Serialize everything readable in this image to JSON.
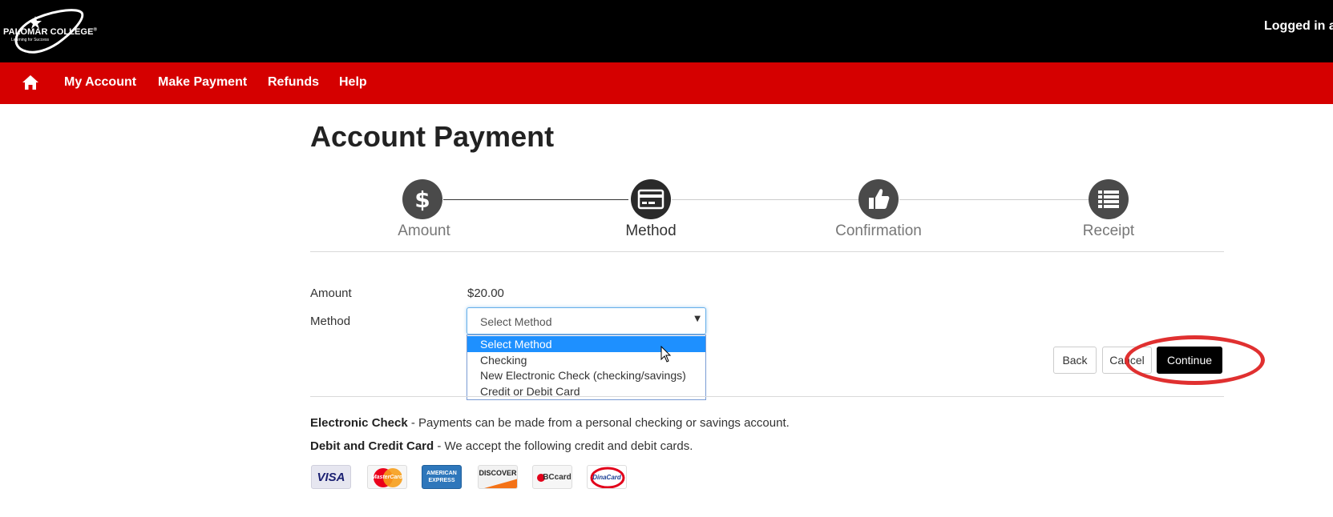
{
  "header": {
    "logo_name": "PALOMAR COLLEGE",
    "logo_mark": "®",
    "logo_tagline": "Learning for Success",
    "logged_in_text": "Logged in a"
  },
  "nav": {
    "home_icon": "home-icon",
    "items": [
      {
        "label": "My Account"
      },
      {
        "label": "Make Payment"
      },
      {
        "label": "Refunds"
      },
      {
        "label": "Help"
      }
    ]
  },
  "page": {
    "title": "Account Payment"
  },
  "steps": [
    {
      "label": "Amount",
      "icon": "dollar-icon",
      "active": false
    },
    {
      "label": "Method",
      "icon": "credit-card-icon",
      "active": true
    },
    {
      "label": "Confirmation",
      "icon": "thumbs-up-icon",
      "active": false
    },
    {
      "label": "Receipt",
      "icon": "list-icon",
      "active": false
    }
  ],
  "form": {
    "amount_label": "Amount",
    "amount_value": "$20.00",
    "method_label": "Method",
    "method_selected": "Select Method",
    "method_options": [
      {
        "label": "Select Method",
        "selected": true
      },
      {
        "label": "Checking",
        "selected": false
      },
      {
        "label": "New Electronic Check (checking/savings)",
        "selected": false
      },
      {
        "label": "Credit or Debit Card",
        "selected": false
      }
    ]
  },
  "buttons": {
    "back": "Back",
    "cancel": "Cancel",
    "continue": "Continue"
  },
  "info": {
    "echeck_title": "Electronic Check",
    "echeck_text": " - Payments can be made from a personal checking or savings  account.",
    "card_title": "Debit and Credit Card",
    "card_text": " - We accept the following credit and debit cards."
  },
  "cards": [
    {
      "label": "VISA",
      "bg": "#e6e6f0",
      "fg": "#1a1f71"
    },
    {
      "label": "MasterCard",
      "bg": "#ffffff",
      "fg": "#ffffff"
    },
    {
      "label": "AMERICAN EXPRESS",
      "bg": "#2e77bb",
      "fg": "#ffffff"
    },
    {
      "label": "DISCOVER",
      "bg": "#f2f2f2",
      "fg": "#222222"
    },
    {
      "label": "BCcard",
      "bg": "#f6f6f6",
      "fg": "#333333"
    },
    {
      "label": "DinaCard",
      "bg": "#ffffff",
      "fg": "#1c3f94"
    }
  ],
  "colors": {
    "header_bg": "#000000",
    "nav_bg": "#d50000",
    "step_circle": "#4a4a4a",
    "primary_button": "#000000",
    "highlight": "#e03030",
    "dropdown_selected": "#1e90ff"
  }
}
